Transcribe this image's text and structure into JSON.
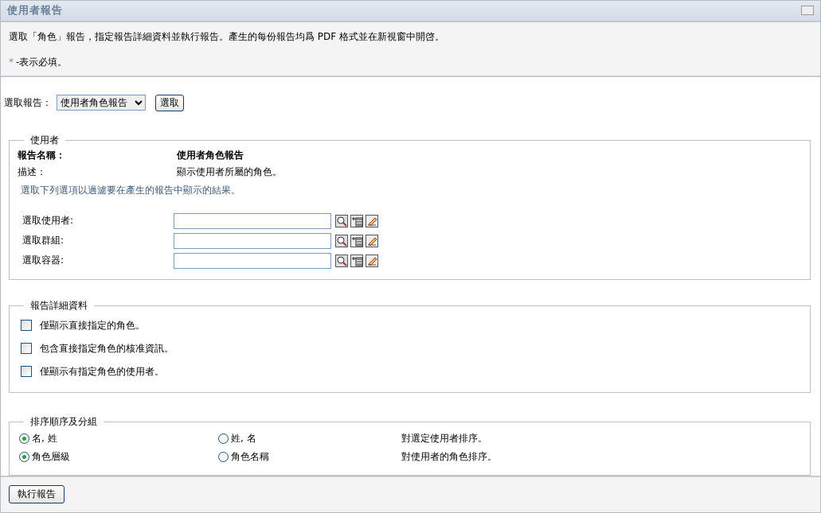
{
  "window": {
    "title": "使用者報告"
  },
  "intro": {
    "text": "選取「角色」報告，指定報告詳細資料並執行報告。產生的每份報告均爲 PDF 格式並在新視窗中開啓。",
    "required_mark": "*",
    "required_text": "-表示必填。"
  },
  "report_select": {
    "label": "選取報告：",
    "value": "使用者角色報告",
    "button": "選取"
  },
  "users_section": {
    "legend": "使用者",
    "info": [
      {
        "label": "報告名稱：",
        "value": "使用者角色報告",
        "kind": "bold"
      },
      {
        "label": "描述：",
        "value": "顯示使用者所屬的角色。",
        "kind": "plain"
      }
    ],
    "hint": "選取下列選項以過濾要在產生的報告中顯示的結果。",
    "fields": [
      {
        "label": "選取使用者:"
      },
      {
        "label": "選取群組:"
      },
      {
        "label": "選取容器:"
      }
    ]
  },
  "details_section": {
    "legend": "報告詳細資料",
    "options": [
      {
        "label": "僅顯示直接指定的角色。",
        "checked": false
      },
      {
        "label": "包含直接指定角色的核准資訊。",
        "checked": false
      },
      {
        "label": "僅顯示有指定角色的使用者。",
        "checked": false
      }
    ]
  },
  "sort_section": {
    "legend": "排序順序及分組",
    "rows": [
      {
        "options": [
          {
            "label": "名, 姓",
            "selected": true
          },
          {
            "label": "姓, 名",
            "selected": false
          }
        ],
        "description": "對選定使用者排序。"
      },
      {
        "options": [
          {
            "label": "角色層級",
            "selected": true
          },
          {
            "label": "角色名稱",
            "selected": false
          }
        ],
        "description": "對使用者的角色排序。"
      }
    ]
  },
  "run_button": "執行報告"
}
